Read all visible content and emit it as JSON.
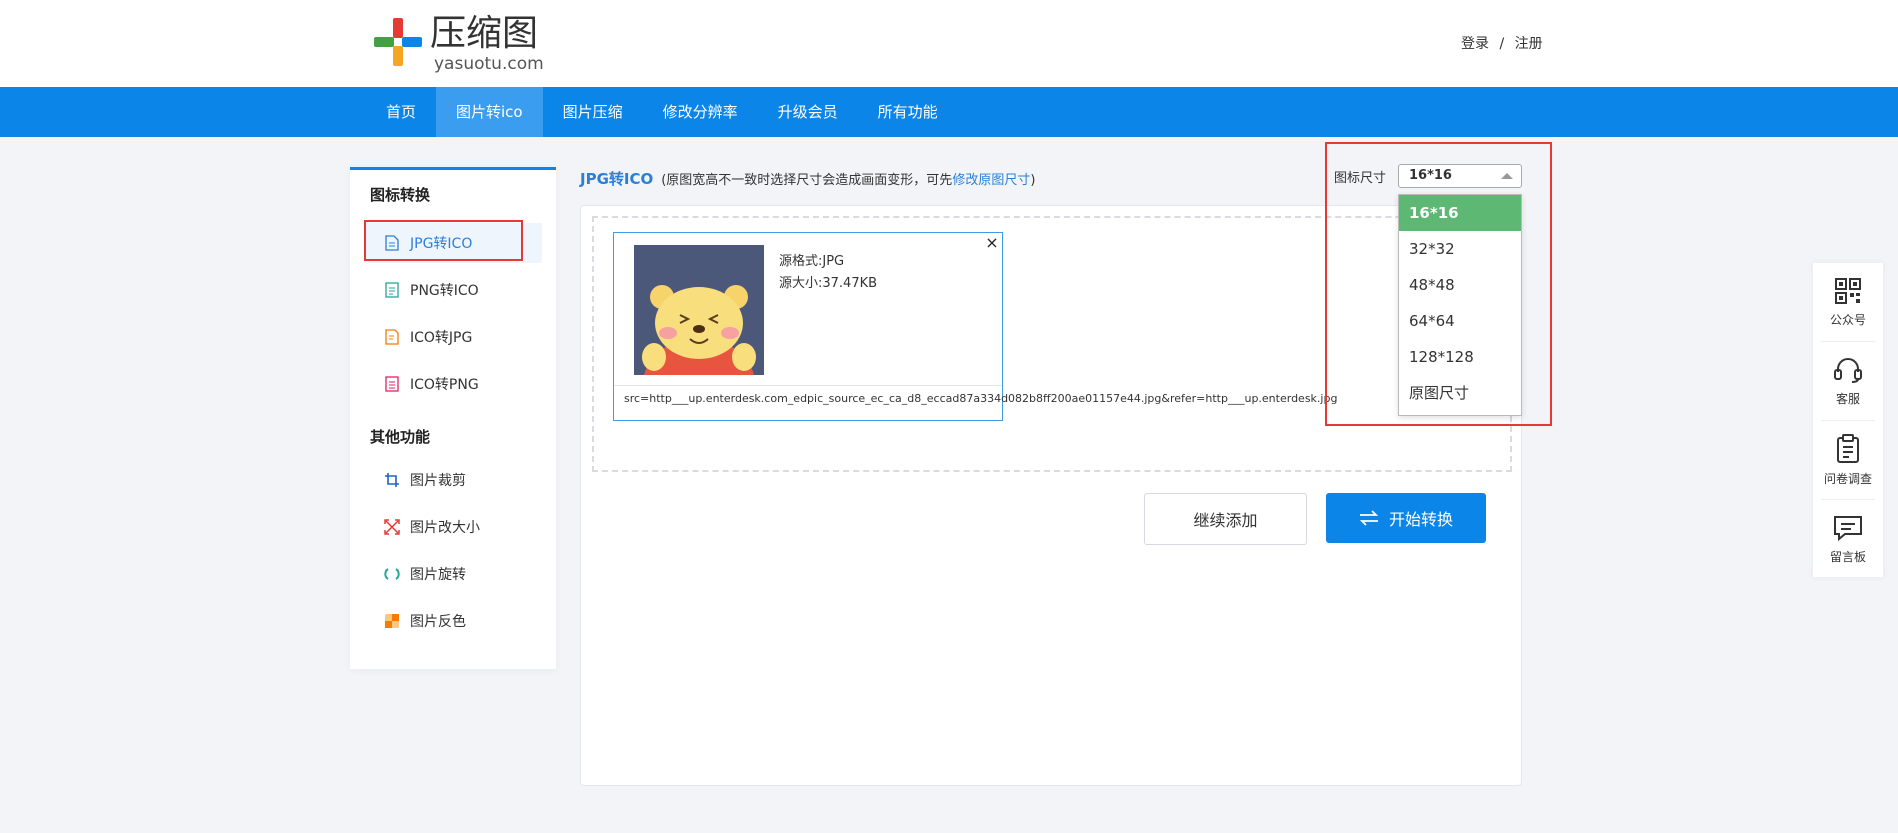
{
  "header": {
    "logo_title": "压缩图",
    "logo_sub": "yasuotu.com",
    "login": "登录",
    "separator": "/",
    "register": "注册"
  },
  "nav": {
    "items": [
      {
        "label": "首页"
      },
      {
        "label": "图片转ico"
      },
      {
        "label": "图片压缩"
      },
      {
        "label": "修改分辨率"
      },
      {
        "label": "升级会员"
      },
      {
        "label": "所有功能"
      }
    ],
    "active_index": 1
  },
  "sidebar": {
    "group1": "图标转换",
    "group2": "其他功能",
    "items": [
      {
        "label": "JPG转ICO",
        "icon": "document-icon"
      },
      {
        "label": "PNG转ICO",
        "icon": "document-icon"
      },
      {
        "label": "ICO转JPG",
        "icon": "document-edit-icon"
      },
      {
        "label": "ICO转PNG",
        "icon": "document-icon"
      },
      {
        "label": "图片裁剪",
        "icon": "crop-icon"
      },
      {
        "label": "图片改大小",
        "icon": "resize-icon"
      },
      {
        "label": "图片旋转",
        "icon": "rotate-icon"
      },
      {
        "label": "图片反色",
        "icon": "invert-icon"
      }
    ]
  },
  "main": {
    "title": "JPG转ICO",
    "hint_prefix": "(原图宽高不一致时选择尺寸会造成画面变形，可先",
    "hint_link": "修改原图尺寸",
    "hint_suffix": ")",
    "size_label": "图标尺寸",
    "size_selected": "16*16",
    "size_options": [
      "16*16",
      "32*32",
      "48*48",
      "64*64",
      "128*128",
      "原图尺寸"
    ],
    "file": {
      "format": "源格式:JPG",
      "size": "源大小:37.47KB",
      "src": "src=http___up.enterdesk.com_edpic_source_ec_ca_d8_eccad87a334d082b8ff200ae01157e44.jpg&refer=http___up.enterdesk.jpg",
      "close": "×"
    },
    "btn_add": "继续添加",
    "btn_start": "开始转换"
  },
  "float_bar": {
    "items": [
      {
        "label": "公众号",
        "icon": "qrcode-icon"
      },
      {
        "label": "客服",
        "icon": "headset-icon"
      },
      {
        "label": "问卷调查",
        "icon": "clipboard-icon"
      },
      {
        "label": "留言板",
        "icon": "message-icon"
      }
    ]
  },
  "colors": {
    "primary": "#0b85e8",
    "selected_option": "#5cb873",
    "highlight_box": "#e53935"
  }
}
